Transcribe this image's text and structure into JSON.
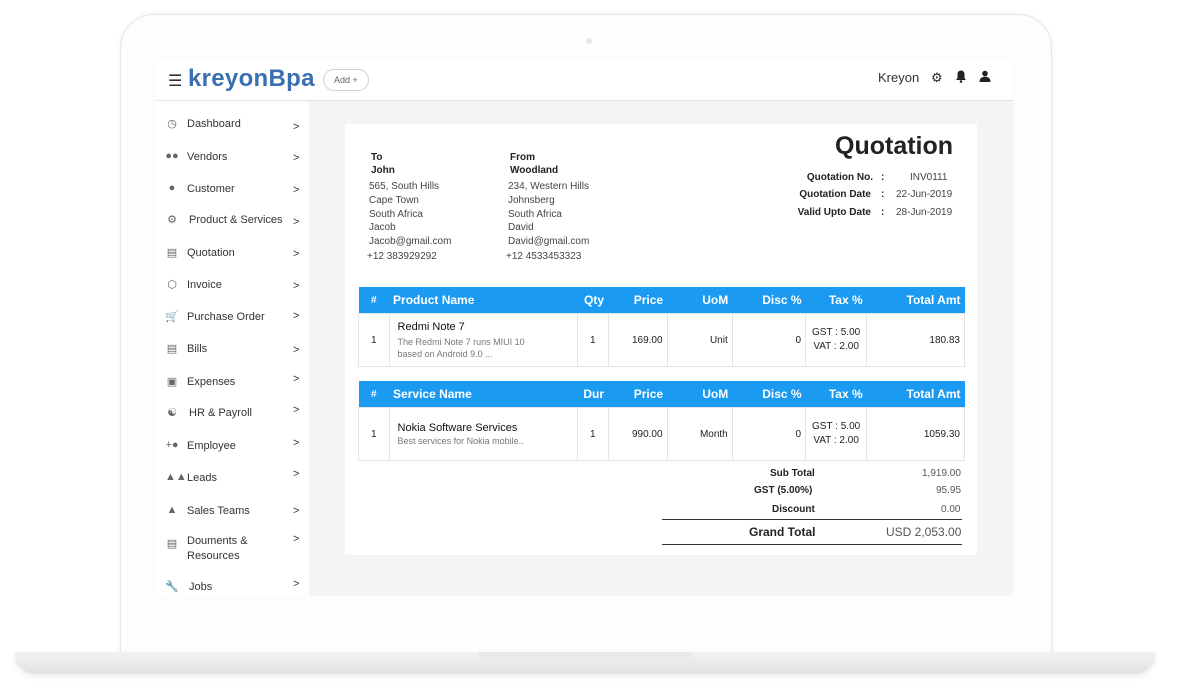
{
  "header": {
    "logo": "kreyonBpa",
    "add_label": "Add  +",
    "user_name": "Kreyon",
    "icons": [
      "menu-icon",
      "gear-icon",
      "bell-icon",
      "user-icon"
    ]
  },
  "sidebar": {
    "items": [
      {
        "label": "Dashboard",
        "icon": "dashboard-icon"
      },
      {
        "label": "Vendors",
        "icon": "vendors-icon"
      },
      {
        "label": "Customer",
        "icon": "customer-icon"
      },
      {
        "label": "Product & Services",
        "icon": "gear-icon"
      },
      {
        "label": "Quotation",
        "icon": "quotation-icon"
      },
      {
        "label": "Invoice",
        "icon": "invoice-icon"
      },
      {
        "label": "Purchase Order",
        "icon": "cart-icon"
      },
      {
        "label": "Bills",
        "icon": "bills-icon"
      },
      {
        "label": "Expenses",
        "icon": "expenses-icon"
      },
      {
        "label": "HR & Payroll",
        "icon": "hr-icon"
      },
      {
        "label": "Employee",
        "icon": "employee-icon"
      },
      {
        "label": "Leads",
        "icon": "leads-icon"
      },
      {
        "label": "Sales Teams",
        "icon": "sales-teams-icon"
      },
      {
        "label": "Douments &",
        "label2": "Resources",
        "icon": "document-icon"
      },
      {
        "label": "Jobs",
        "icon": "wrench-icon"
      }
    ],
    "arrow": ">"
  },
  "quotation": {
    "title": "Quotation",
    "to": {
      "label": "To",
      "name": "John",
      "lines": [
        "565, South Hills",
        "Cape Town",
        "South Africa",
        "Jacob",
        "Jacob@gmail.com",
        "+12 383929292"
      ]
    },
    "from": {
      "label": "From",
      "name": "Woodland",
      "lines": [
        "234, Western Hills",
        "Johnsberg",
        "South Africa",
        "David",
        "David@gmail.com",
        "+12 4533453323"
      ]
    },
    "meta": [
      {
        "label": "Quotation No.",
        "sep": ":",
        "value": "INV0111"
      },
      {
        "label": "Quotation Date",
        "sep": ":",
        "value": "22-Jun-2019"
      },
      {
        "label": "Valid Upto Date",
        "sep": ":",
        "value": "28-Jun-2019"
      }
    ],
    "product_table": {
      "headers": [
        "#",
        "Product Name",
        "Qty",
        "Price",
        "UoM",
        "Disc %",
        "Tax %",
        "Total Amt"
      ],
      "rows": [
        {
          "num": "1",
          "name": "Redmi Note 7",
          "desc1": "The Redmi Note 7 runs MIUI 10",
          "desc2": "based on Android 9.0 ...",
          "qty": "1",
          "price": "169.00",
          "uom": "Unit",
          "disc": "0",
          "tax1": "GST : 5.00",
          "tax2": "VAT : 2.00",
          "total": "180.83"
        }
      ]
    },
    "service_table": {
      "headers": [
        "#",
        "Service Name",
        "Dur",
        "Price",
        "UoM",
        "Disc %",
        "Tax %",
        "Total Amt"
      ],
      "rows": [
        {
          "num": "1",
          "name": "Nokia Software Services",
          "desc1": "Best services for Nokia mobile..",
          "desc2": "",
          "qty": "1",
          "price": "990.00",
          "uom": "Month",
          "disc": "0",
          "tax1": "GST : 5.00",
          "tax2": "VAT : 2.00",
          "total": "1059.30"
        }
      ]
    },
    "totals": {
      "sub_total_label": "Sub Total",
      "sub_total": "1,919.00",
      "gst_label": "GST (5.00%)",
      "gst": "95.95",
      "discount_label": "Discount",
      "discount": "0.00",
      "grand_total_label": "Grand Total",
      "grand_total": "USD 2,053.00"
    }
  }
}
